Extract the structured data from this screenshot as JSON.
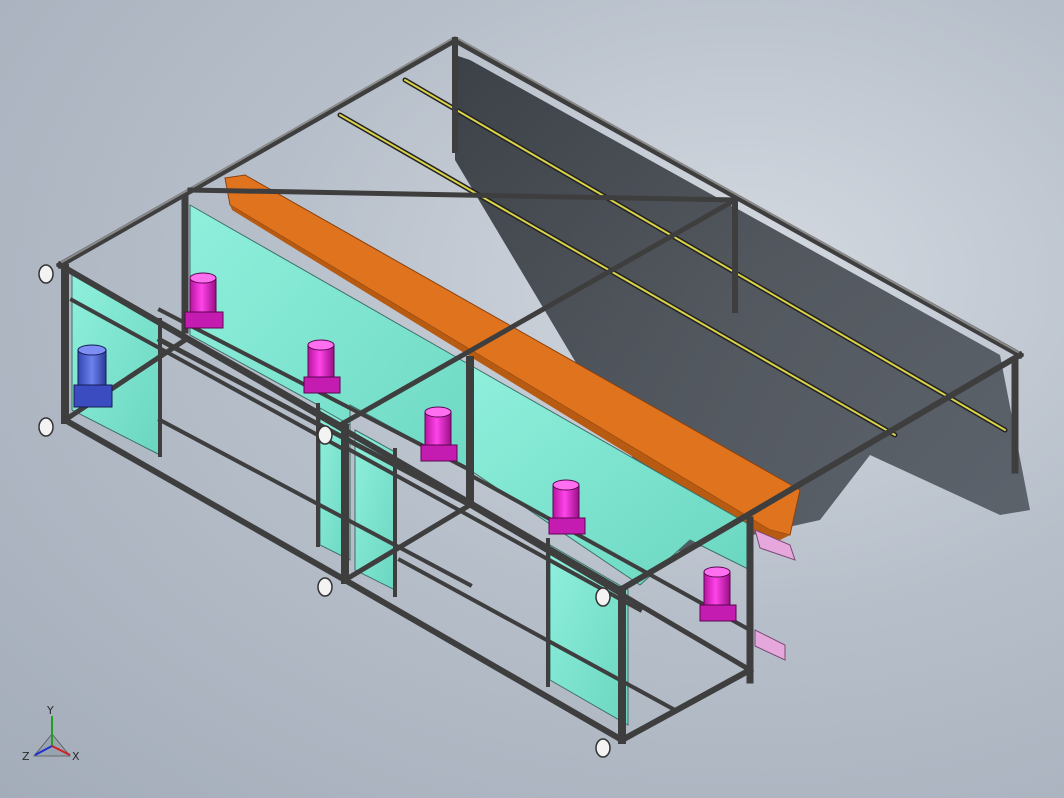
{
  "viewport": {
    "background_top": "#d5dae1",
    "background_bottom": "#a3acb9"
  },
  "model": {
    "frame_color": "#3e3e3e",
    "panel_color": "#7fe3cf",
    "chute_color": "#e0731d",
    "cylinder_color": "#e21fd0",
    "motor_color": "#4a5fd0",
    "rail_color": "#d9d34a",
    "bracket_color": "#e6a8dc"
  },
  "triad": {
    "x_label": "X",
    "y_label": "Y",
    "z_label": "Z",
    "x_color": "#d02020",
    "y_color": "#20a020",
    "z_color": "#2030d0"
  }
}
